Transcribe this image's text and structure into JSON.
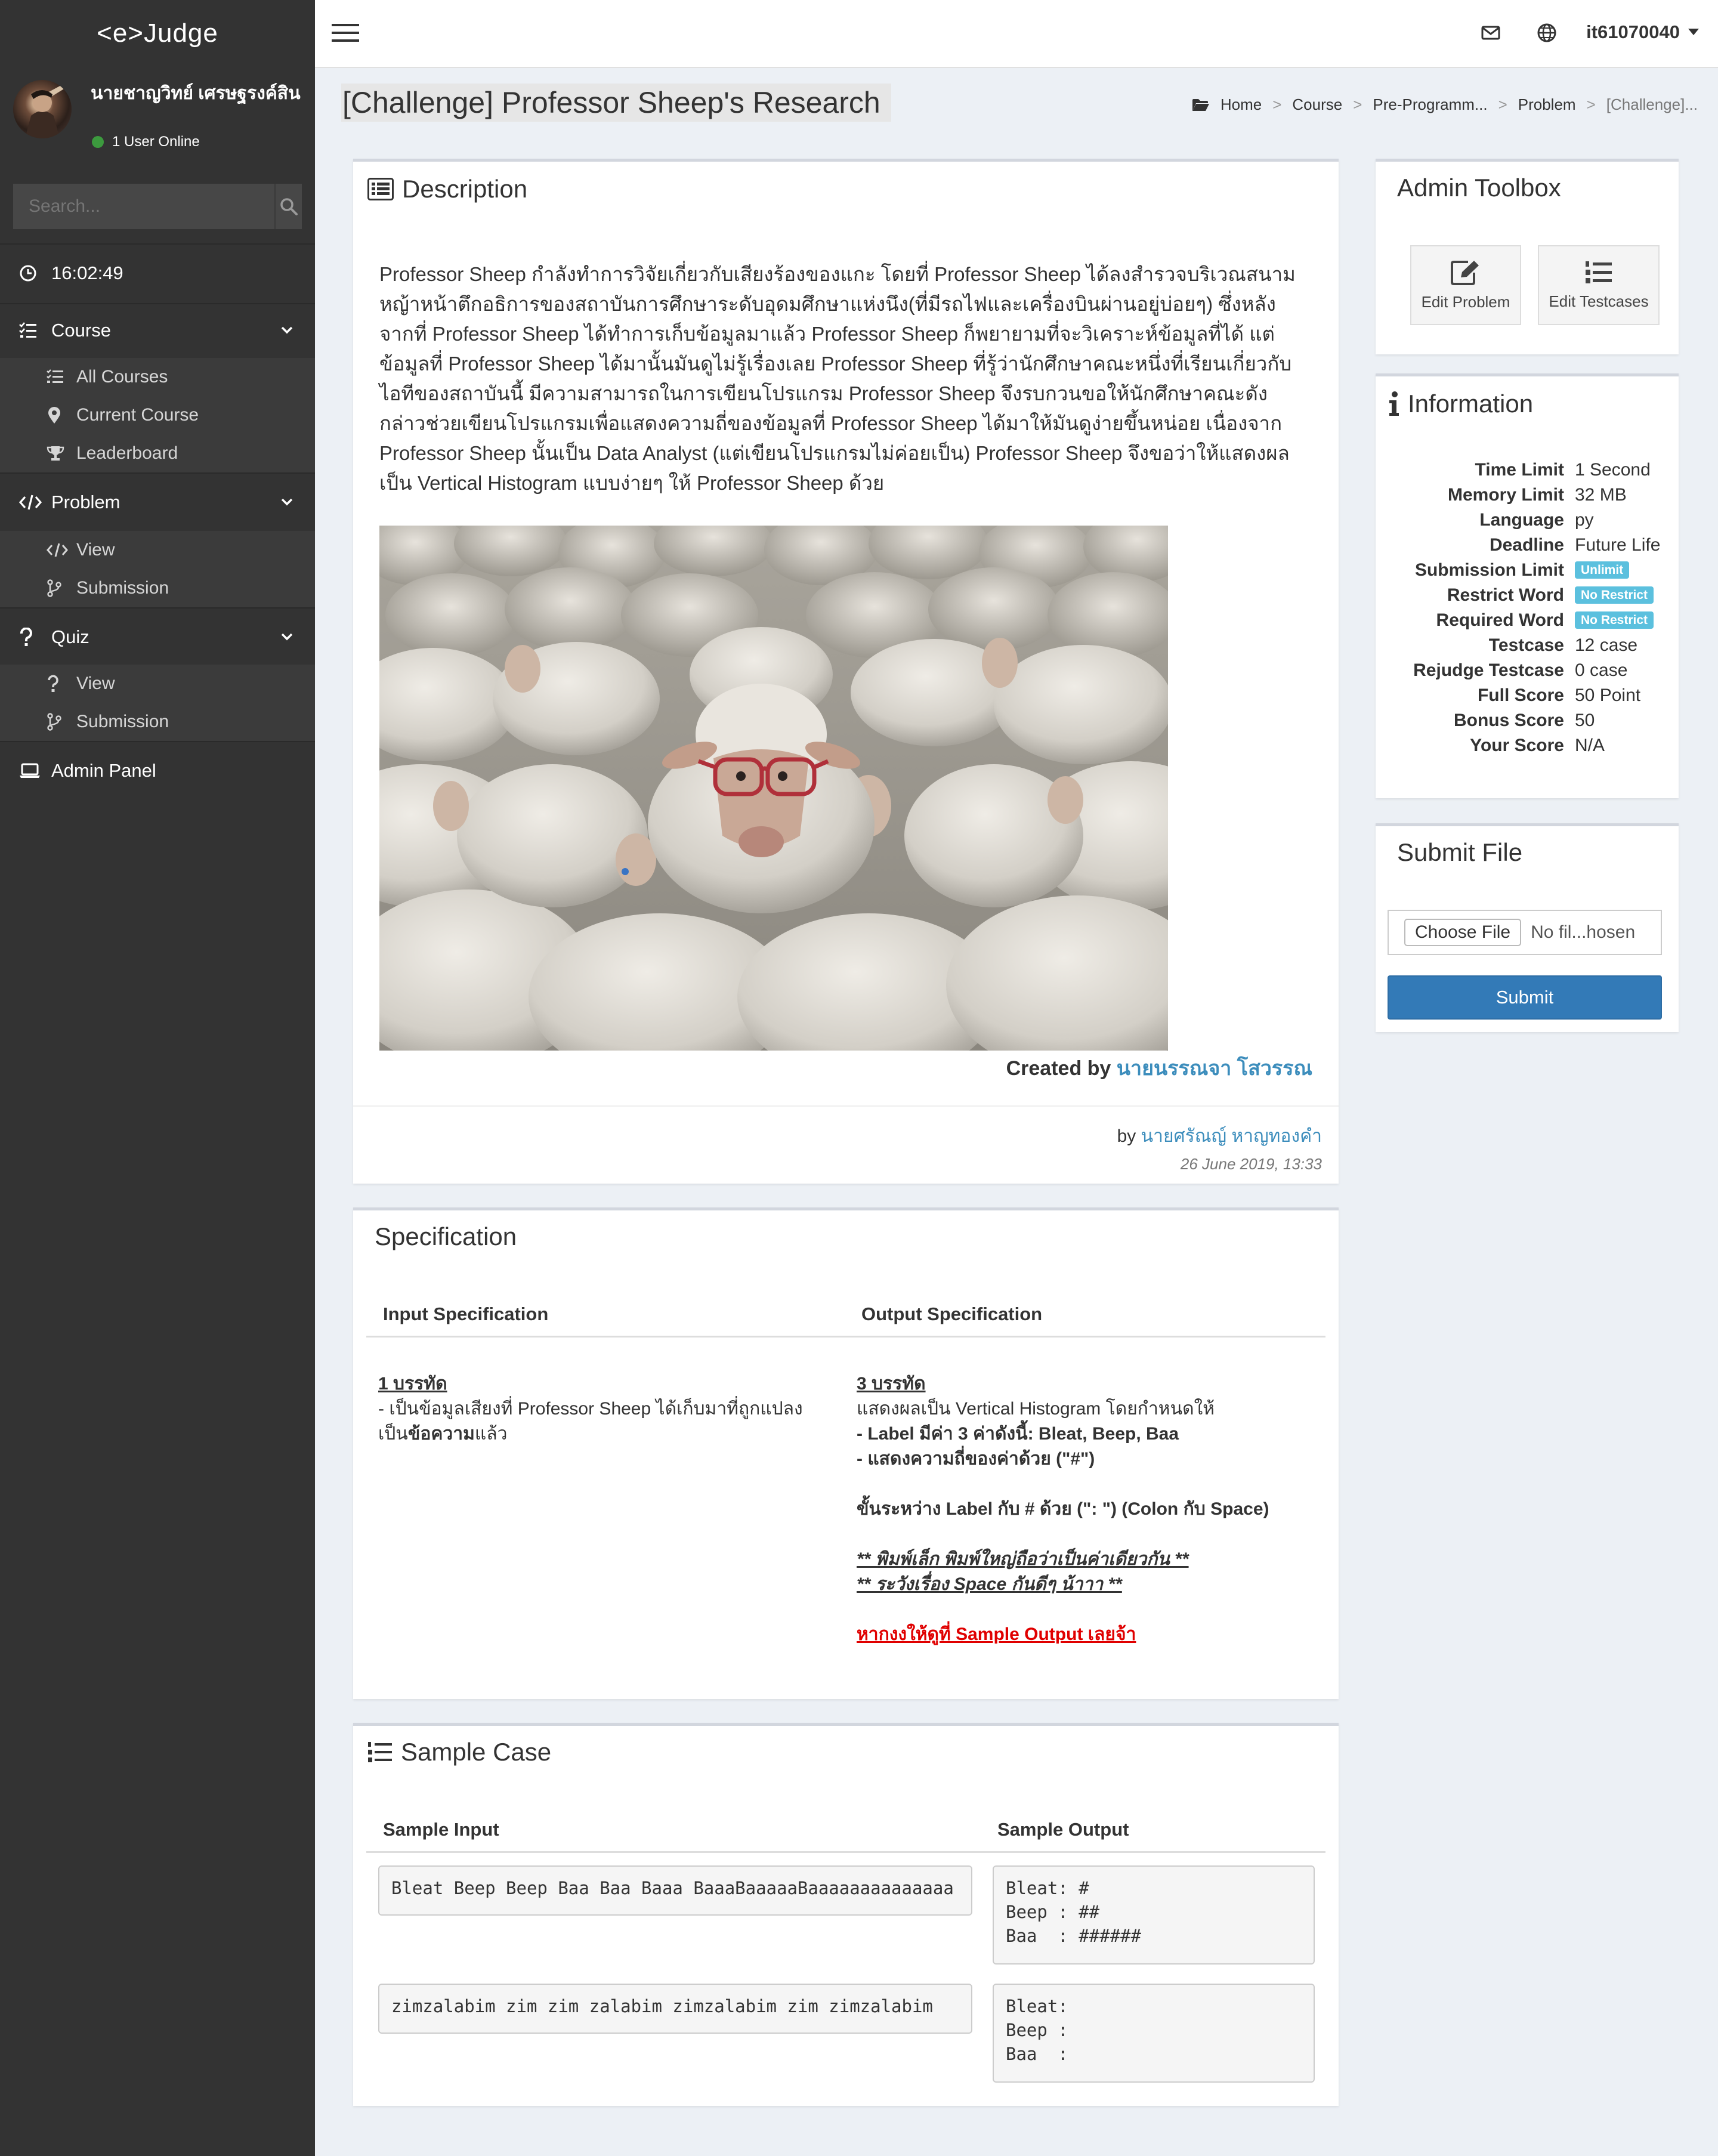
{
  "brand": "<e>Judge",
  "user": {
    "name": "นายชาญวิทย์ เศรษฐรงค์สิน",
    "status": "1 User Online"
  },
  "search": {
    "placeholder": "Search..."
  },
  "clock": "16:02:49",
  "sidebar": {
    "course": {
      "label": "Course",
      "items": [
        "All Courses",
        "Current Course",
        "Leaderboard"
      ]
    },
    "problem": {
      "label": "Problem",
      "items": [
        "View",
        "Submission"
      ]
    },
    "quiz": {
      "label": "Quiz",
      "items": [
        "View",
        "Submission"
      ]
    },
    "admin": "Admin Panel"
  },
  "topbar": {
    "username": "it61070040"
  },
  "page_title": "[Challenge] Professor Sheep's Research",
  "breadcrumb": [
    "Home",
    "Course",
    "Pre-Programm...",
    "Problem",
    "[Challenge]..."
  ],
  "description": {
    "title": "Description",
    "body": "Professor Sheep กำลังทำการวิจัยเกี่ยวกับเสียงร้องของแกะ โดยที่ Professor Sheep ได้ลงสำรวจบริเวณสนามหญ้าหน้าตึกอธิการของสถาบันการศึกษาระดับอุดมศึกษาแห่งนึง(ที่มีรถไฟและเครื่องบินผ่านอยู่บ่อยๆ) ซึ่งหลังจากที่ Professor Sheep ได้ทำการเก็บข้อมูลมาแล้ว Professor Sheep ก็พยายามที่จะวิเคราะห์ข้อมูลที่ได้ แต่ข้อมูลที่ Professor Sheep ได้มานั้นมันดูไม่รู้เรื่องเลย Professor Sheep ที่รู้ว่านักศึกษาคณะหนึ่งที่เรียนเกี่ยวกับไอทีของสถาบันนี้ มีความสามารถในการเขียนโปรแกรม Professor Sheep จึงรบกวนขอให้นักศึกษาคณะดังกล่าวช่วยเขียนโปรแกรมเพื่อแสดงความถี่ของข้อมูลที่ Professor Sheep ได้มาให้มันดูง่ายขึ้นหน่อย เนื่องจาก Professor Sheep นั้นเป็น Data Analyst (แต่เขียนโปรแกรมไม่ค่อยเป็น) Professor Sheep จึงขอว่าให้แสดงผลเป็น Vertical Histogram แบบง่ายๆ ให้ Professor Sheep ด้วย",
    "created_by_label": "Created by",
    "created_by_name": "นายนรรณจา โสวรรณ",
    "by_label": "by",
    "author": "นายศรัณญ์ หาญทองคำ",
    "date": "26 June 2019, 13:33"
  },
  "admin_toolbox": {
    "title": "Admin Toolbox",
    "edit_problem": "Edit Problem",
    "edit_testcases": "Edit Testcases"
  },
  "information": {
    "title": "Information",
    "rows": [
      {
        "key": "Time Limit",
        "value": "1 Second"
      },
      {
        "key": "Memory Limit",
        "value": "32 MB"
      },
      {
        "key": "Language",
        "value": "py"
      },
      {
        "key": "Deadline",
        "value": "Future Life"
      },
      {
        "key": "Submission Limit",
        "value": "Unlimit",
        "badge": true
      },
      {
        "key": "Restrict Word",
        "value": "No Restrict",
        "badge": true
      },
      {
        "key": "Required Word",
        "value": "No Restrict",
        "badge": true
      },
      {
        "key": "Testcase",
        "value": "12 case"
      },
      {
        "key": "Rejudge Testcase",
        "value": "0 case"
      },
      {
        "key": "Full Score",
        "value": "50 Point"
      },
      {
        "key": "Bonus Score",
        "value": "50"
      },
      {
        "key": "Your Score",
        "value": "N/A"
      }
    ]
  },
  "submit": {
    "title": "Submit File",
    "choose_file": "Choose File",
    "no_file": "No fil...hosen",
    "button": "Submit"
  },
  "specification": {
    "title": "Specification",
    "input_header": "Input Specification",
    "output_header": "Output Specification",
    "input_lines_title": "1 บรรทัด",
    "input_line1": "- เป็นข้อมูลเสียงที่ Professor Sheep ได้เก็บมาที่ถูกแปลง",
    "input_line2a": "เป็น",
    "input_line2b": "ข้อความ",
    "input_line2c": "แล้ว",
    "output_lines_title": "3 บรรทัด",
    "output_line1": "แสดงผลเป็น Vertical Histogram โดยกำหนดให้",
    "output_line2": "- Label มีค่า 3 ค่าดังนี้: Bleat, Beep, Baa",
    "output_line3": "- แสดงความถี่ของค่าด้วย (\"#\")",
    "output_line4": "ขั้นระหว่าง Label กับ # ด้วย (\": \") (Colon กับ Space)",
    "output_note1": "** พิมพ์เล็ก พิมพ์ใหญ่ถือว่าเป็นค่าเดียวกัน **",
    "output_note2": "** ระวังเรื่อง Space กันดีๆ น้าาา **",
    "output_note3": "หากงงให้ดูที่ Sample Output เลยจ้า"
  },
  "sample_case": {
    "title": "Sample Case",
    "input_header": "Sample Input",
    "output_header": "Sample Output",
    "cases": [
      {
        "input": "Bleat Beep Beep Baa Baa Baaa BaaaBaaaaaBaaaaaaaaaaaaaa",
        "output": "Bleat: #\nBeep : ##\nBaa  : ######"
      },
      {
        "input": "zimzalabim zim zim zalabim zimzalabim zim zimzalabim",
        "output": "Bleat:\nBeep :\nBaa  :"
      }
    ]
  },
  "colors": {
    "sidebar": "#333333",
    "accent": "#3c8dbc",
    "badge": "#5bc0de",
    "button": "#337ab7",
    "online": "#3c9a3e",
    "warning_text": "#e00000"
  }
}
